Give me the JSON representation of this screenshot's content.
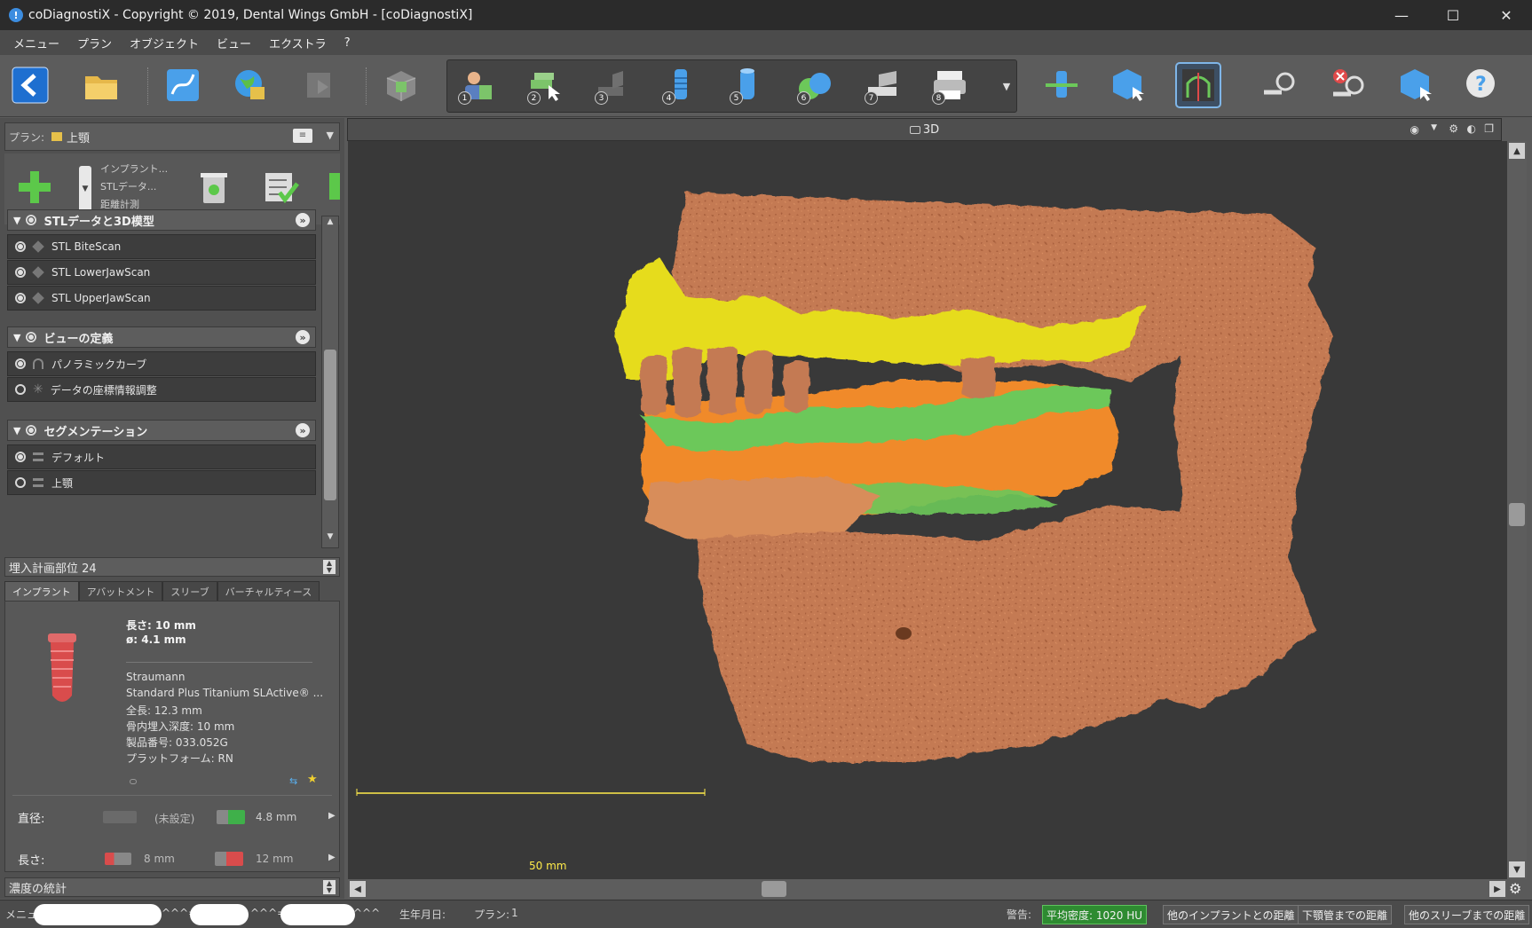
{
  "window": {
    "title": "coDiagnostiX - Copyright © 2019, Dental Wings GmbH - [coDiagnostiX]",
    "minimize": "—",
    "maximize": "☐",
    "close": "✕"
  },
  "menu": [
    "メニュー",
    "プラン",
    "オブジェクト",
    "ビュー",
    "エクストラ",
    "?"
  ],
  "toolbar": {
    "wizard_steps": [
      "1",
      "2",
      "3",
      "4",
      "5",
      "6",
      "7",
      "8"
    ]
  },
  "plan": {
    "label": "プラン:",
    "name": "上顎",
    "add_menu_items": [
      "インプラント...",
      "STLデータ...",
      "距離計測"
    ]
  },
  "tree": {
    "groups": [
      {
        "title": "STLデータと3D模型",
        "items": [
          {
            "label": "STL BiteScan",
            "selected": true
          },
          {
            "label": "STL LowerJawScan",
            "selected": true
          },
          {
            "label": "STL UpperJawScan",
            "selected": true
          }
        ]
      },
      {
        "title": "ビューの定義",
        "items": [
          {
            "label": "パノラミックカーブ",
            "selected": true
          },
          {
            "label": "データの座標情報調整",
            "selected": false
          }
        ]
      },
      {
        "title": "セグメンテーション",
        "items": [
          {
            "label": "デフォルト",
            "selected": true
          },
          {
            "label": "上顎",
            "selected": false
          }
        ]
      }
    ]
  },
  "implant": {
    "section_title": "埋入計画部位 24",
    "tabs": [
      "インプラント",
      "アバットメント",
      "スリーブ",
      "バーチャルティース"
    ],
    "length": "長さ: 10 mm",
    "diameter": "ø: 4.1 mm",
    "manufacturer": "Straumann",
    "product": "Standard Plus Titanium SLActive® ...",
    "total_length": "全長: 12.3 mm",
    "bone_depth": "骨内埋入深度: 10 mm",
    "article_no": "製品番号: 033.052G",
    "platform": "プラットフォーム: RN",
    "diameter_row": {
      "label": "直径:",
      "min": "(未設定)",
      "max": "4.8 mm"
    },
    "length_row": {
      "label": "長さ:",
      "min": "8 mm",
      "max": "12 mm"
    }
  },
  "density_section": "濃度の統計",
  "viewport": {
    "title": "3D",
    "scale": "50 mm",
    "colors": {
      "bone": "#c47a52",
      "upper_scan": "#e6dc1e",
      "lower_scan": "#f08a2a",
      "bite": "#6cc85a",
      "background": "#393939"
    }
  },
  "status": {
    "menu_prefix": "メニュー",
    "marks": [
      "^^^=",
      "^^^=",
      "^^^"
    ],
    "dob_label": "生年月日:",
    "plan_label": "プラン:",
    "plan_value": "1",
    "warning_label": "警告:",
    "buttons": [
      "平均密度: 1020 HU",
      "他のインプラントとの距離",
      "下顎管までの距離",
      "他のスリーブまでの距離"
    ]
  }
}
